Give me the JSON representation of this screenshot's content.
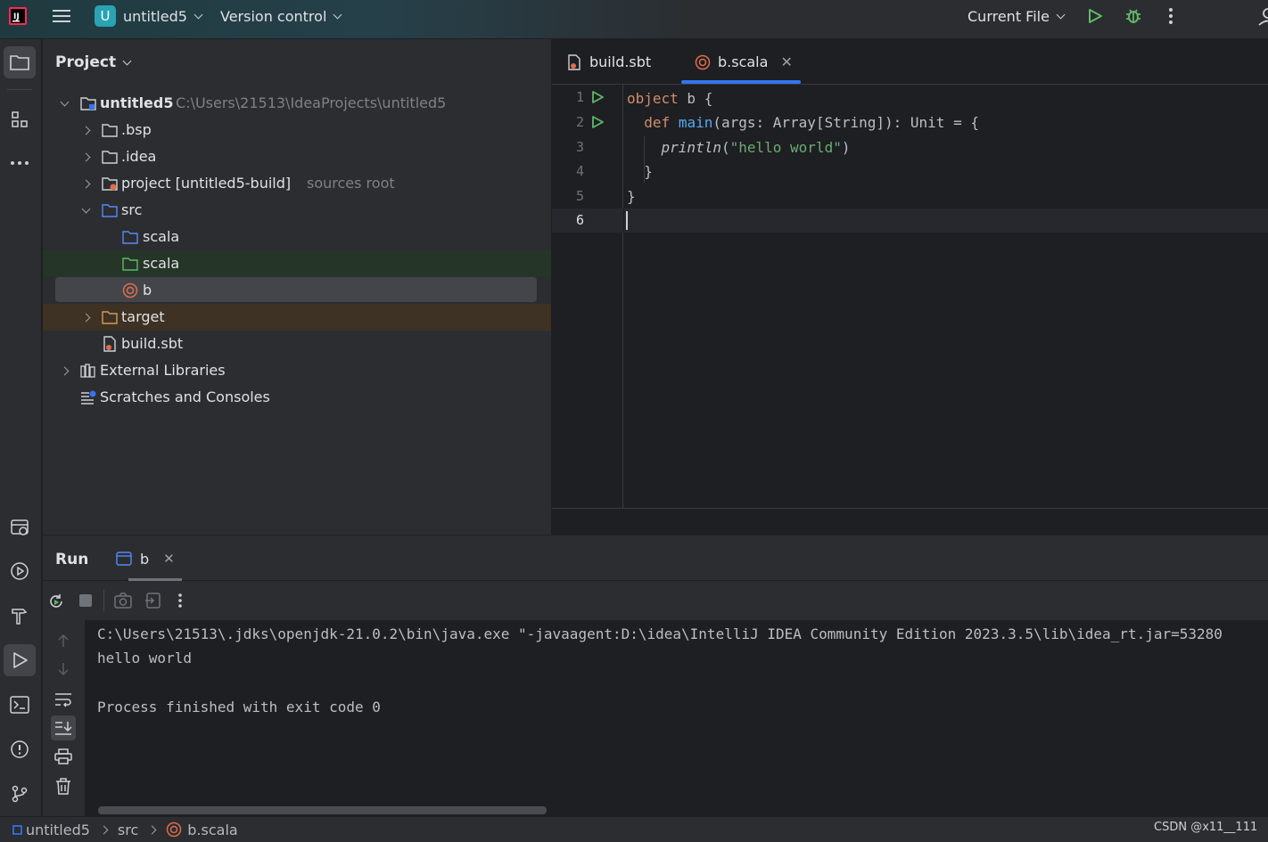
{
  "titlebar": {
    "project_badge": "U",
    "project_name": "untitled5",
    "vcs_label": "Version control",
    "run_config": "Current File"
  },
  "project_panel": {
    "title": "Project",
    "tree": [
      {
        "name": "untitled5",
        "hint": "C:\\Users\\21513\\IdeaProjects\\untitled5"
      },
      {
        "name": ".bsp"
      },
      {
        "name": ".idea"
      },
      {
        "name": "project [untitled5-build]",
        "hint": "sources root"
      },
      {
        "name": "src"
      },
      {
        "name": "scala"
      },
      {
        "name": "scala"
      },
      {
        "name": "b"
      },
      {
        "name": "target"
      },
      {
        "name": "build.sbt"
      },
      {
        "name": "External Libraries"
      },
      {
        "name": "Scratches and Consoles"
      }
    ]
  },
  "editor": {
    "tabs": [
      {
        "label": "build.sbt"
      },
      {
        "label": "b.scala"
      }
    ],
    "line_numbers": [
      "1",
      "2",
      "3",
      "4",
      "5",
      "6"
    ],
    "code": {
      "l1_kw": "object",
      "l1_rest": " b {",
      "l2_kw": "def",
      "l2_fn": "main",
      "l2_rest": "(args: Array[String]): Unit = {",
      "l3_fn": "println",
      "l3_open": "(",
      "l3_str": "\"hello world\"",
      "l3_close": ")",
      "l4": "}",
      "l5": "}"
    }
  },
  "run_panel": {
    "title": "Run",
    "tab_label": "b",
    "console": [
      "C:\\Users\\21513\\.jdks\\openjdk-21.0.2\\bin\\java.exe \"-javaagent:D:\\idea\\IntelliJ IDEA Community Edition 2023.3.5\\lib\\idea_rt.jar=53280",
      "hello world",
      "",
      "Process finished with exit code 0"
    ]
  },
  "statusbar": {
    "crumb_project": "untitled5",
    "crumb_src": "src",
    "crumb_file": "b.scala",
    "watermark": "CSDN @x11__111"
  },
  "colors": {
    "accent": "#3574f0",
    "run_green": "#5fb865",
    "scala_red": "#e06c4a"
  }
}
